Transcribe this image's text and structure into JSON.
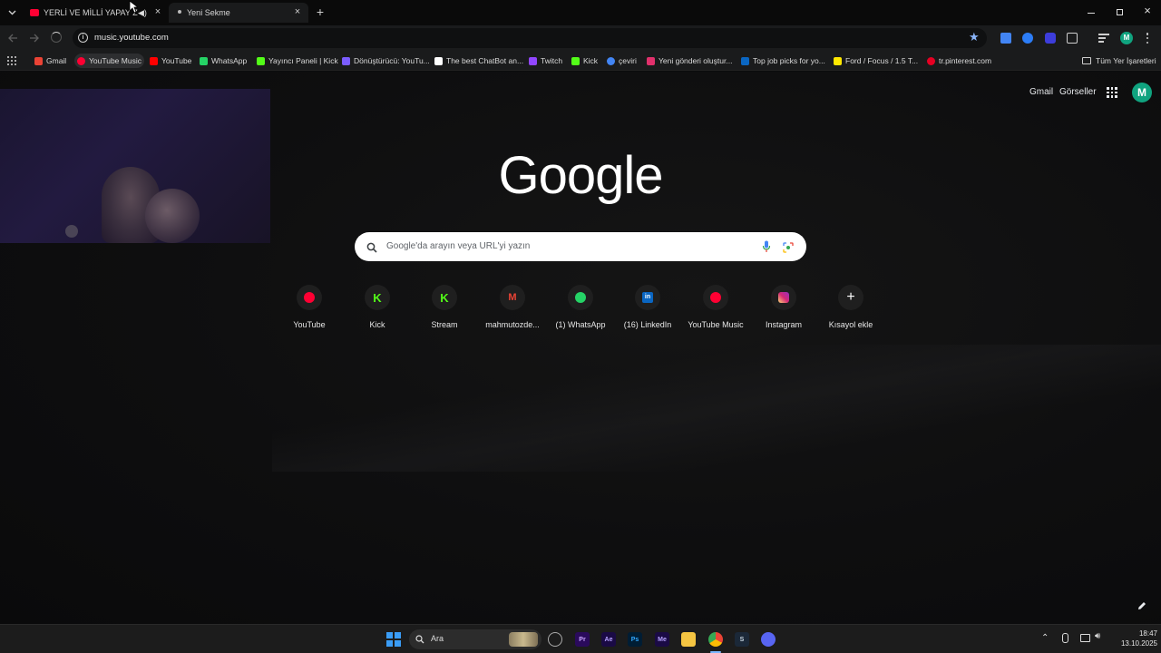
{
  "browser": {
    "tabs": [
      {
        "title": "YERLİ VE MİLLİ YAPAY ZEKA"
      },
      {
        "title": "Yeni Sekme"
      }
    ],
    "url": "music.youtube.com"
  },
  "bookmarks": [
    {
      "label": "Gmail",
      "icon": "gmail-icon",
      "color": "#ea4335"
    },
    {
      "label": "YouTube Music",
      "icon": "youtube-music-icon",
      "color": "#ff0033"
    },
    {
      "label": "YouTube",
      "icon": "youtube-icon",
      "color": "#ff0000"
    },
    {
      "label": "WhatsApp",
      "icon": "whatsapp-icon",
      "color": "#25d366"
    },
    {
      "label": "Yayıncı Paneli | Kick",
      "icon": "kick-icon",
      "color": "#53fc18"
    },
    {
      "label": "Dönüştürücü: YouTu...",
      "icon": "converter-icon",
      "color": "#7a5cff"
    },
    {
      "label": "The best ChatBot an...",
      "icon": "chatbot-icon",
      "color": "#ffffff"
    },
    {
      "label": "Twitch",
      "icon": "twitch-icon",
      "color": "#9146ff"
    },
    {
      "label": "Kick",
      "icon": "kick-icon",
      "color": "#53fc18"
    },
    {
      "label": "çeviri",
      "icon": "google-icon",
      "color": "#4285f4"
    },
    {
      "label": "Yeni gönderi oluştur...",
      "icon": "instagram-icon",
      "color": "#e1306c"
    },
    {
      "label": "Top job picks for yo...",
      "icon": "linkedin-icon",
      "color": "#0a66c2"
    },
    {
      "label": "Ford / Focus / 1.5 T...",
      "icon": "sahibinden-icon",
      "color": "#ffe800"
    },
    {
      "label": "tr.pinterest.com",
      "icon": "pinterest-icon",
      "color": "#e60023"
    }
  ],
  "all_bookmarks_label": "Tüm Yer İşaretleri",
  "header_links": {
    "gmail": "Gmail",
    "images": "Görseller",
    "avatar_letter": "M"
  },
  "logo": "Google",
  "search": {
    "placeholder": "Google'da arayın veya URL'yi yazın"
  },
  "shortcuts": [
    {
      "label": "YouTube",
      "icon": "youtube-icon",
      "color": "#ff0033"
    },
    {
      "label": "Kick",
      "icon": "kick-icon",
      "color": "#53fc18"
    },
    {
      "label": "Stream",
      "icon": "kick-icon",
      "color": "#53fc18"
    },
    {
      "label": "mahmutozde...",
      "icon": "gmail-icon",
      "color": "#ea4335"
    },
    {
      "label": "(1) WhatsApp",
      "icon": "whatsapp-icon",
      "color": "#25d366"
    },
    {
      "label": "(16) LinkedIn",
      "icon": "linkedin-icon",
      "color": "#0a66c2"
    },
    {
      "label": "YouTube Music",
      "icon": "youtube-music-icon",
      "color": "#ff0033"
    },
    {
      "label": "Instagram",
      "icon": "instagram-icon",
      "color": "#e1306c"
    },
    {
      "label": "Kısayol ekle",
      "icon": "plus-icon",
      "color": "#ffffff"
    }
  ],
  "taskbar": {
    "search_label": "Ara",
    "time": "18:47",
    "date": "13.10.2025"
  }
}
